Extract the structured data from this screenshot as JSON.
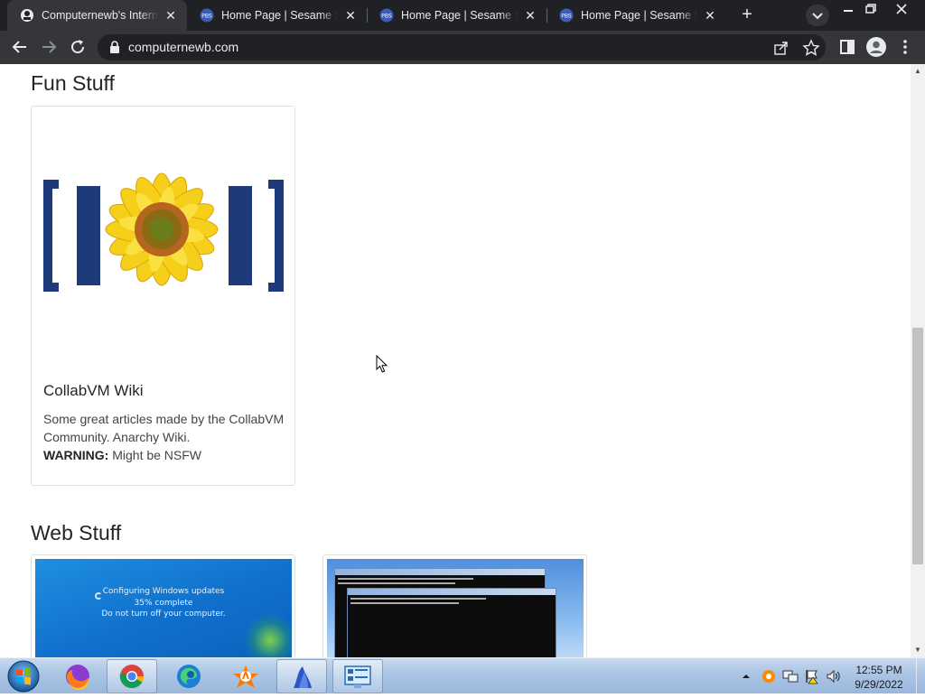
{
  "browser": {
    "tabs": [
      {
        "title": "Computernewb's Internet",
        "active": true
      },
      {
        "title": "Home Page | Sesame Street",
        "active": false
      },
      {
        "title": "Home Page | Sesame Street",
        "active": false
      },
      {
        "title": "Home Page | Sesame Street",
        "active": false
      }
    ],
    "url": "computernewb.com"
  },
  "page": {
    "fun_stuff": {
      "heading": "Fun Stuff",
      "card": {
        "title": "CollabVM Wiki",
        "description": "Some great articles made by the CollabVM Community. Anarchy Wiki.",
        "warning_label": "WARNING:",
        "warning_text": "Might be NSFW"
      }
    },
    "web_stuff": {
      "heading": "Web Stuff",
      "thumb1": {
        "line1": "Configuring Windows updates",
        "line2": "35% complete",
        "line3": "Do not turn off your computer."
      }
    }
  },
  "taskbar": {
    "apps": [
      "firefox-icon",
      "chrome-icon",
      "edge-icon",
      "avast-icon",
      "bird-app-icon",
      "control-panel-icon"
    ],
    "time": "12:55 PM",
    "date": "9/29/2022"
  },
  "colors": {
    "chrome_dark": "#202124",
    "chrome_toolbar": "#35363a",
    "taskbar": "#aac4e3"
  }
}
